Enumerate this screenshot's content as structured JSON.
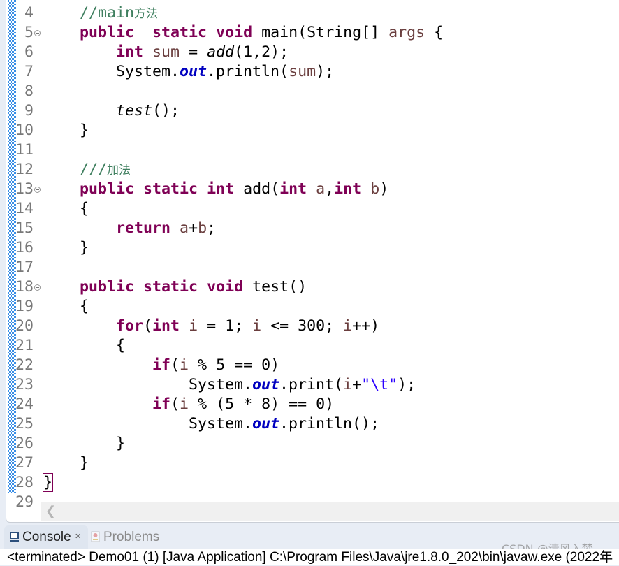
{
  "editor": {
    "lines": [
      {
        "n": "4",
        "fold": false,
        "indent": 1,
        "tokens": [
          [
            "cm",
            "//main"
          ],
          [
            "cmcjk",
            "方法"
          ]
        ]
      },
      {
        "n": "5",
        "fold": true,
        "indent": 1,
        "tokens": [
          [
            "kw",
            "public"
          ],
          [
            "",
            "  "
          ],
          [
            "kw",
            "static"
          ],
          [
            "",
            " "
          ],
          [
            "kw",
            "void"
          ],
          [
            "",
            " main(String[] "
          ],
          [
            "var",
            "args"
          ],
          [
            "",
            " {"
          ]
        ]
      },
      {
        "n": "6",
        "fold": false,
        "indent": 2,
        "tokens": [
          [
            "kw",
            "int"
          ],
          [
            "",
            " "
          ],
          [
            "var",
            "sum"
          ],
          [
            "",
            " = "
          ],
          [
            "it",
            "add"
          ],
          [
            "",
            "(1,2);"
          ]
        ]
      },
      {
        "n": "7",
        "fold": false,
        "indent": 2,
        "tokens": [
          [
            "",
            "System."
          ],
          [
            "fld",
            "out"
          ],
          [
            "",
            ".println("
          ],
          [
            "var",
            "sum"
          ],
          [
            "",
            ");"
          ]
        ]
      },
      {
        "n": "8",
        "fold": false,
        "indent": 0,
        "tokens": []
      },
      {
        "n": "9",
        "fold": false,
        "indent": 2,
        "tokens": [
          [
            "it",
            "test"
          ],
          [
            "",
            "();"
          ]
        ]
      },
      {
        "n": "10",
        "fold": false,
        "indent": 1,
        "tokens": [
          [
            "",
            "}"
          ]
        ]
      },
      {
        "n": "11",
        "fold": false,
        "indent": 0,
        "tokens": []
      },
      {
        "n": "12",
        "fold": false,
        "indent": 1,
        "tokens": [
          [
            "cm",
            "///"
          ],
          [
            "cmcjk",
            "加法"
          ]
        ]
      },
      {
        "n": "13",
        "fold": true,
        "indent": 1,
        "tokens": [
          [
            "kw",
            "public"
          ],
          [
            "",
            " "
          ],
          [
            "kw",
            "static"
          ],
          [
            "",
            " "
          ],
          [
            "kw",
            "int"
          ],
          [
            "",
            " add("
          ],
          [
            "kw",
            "int"
          ],
          [
            "",
            " "
          ],
          [
            "var",
            "a"
          ],
          [
            ","
          ],
          [
            "kw",
            "int"
          ],
          [
            "",
            " "
          ],
          [
            "var",
            "b"
          ],
          [
            "",
            ")"
          ]
        ]
      },
      {
        "n": "14",
        "fold": false,
        "indent": 1,
        "tokens": [
          [
            "",
            "{"
          ]
        ]
      },
      {
        "n": "15",
        "fold": false,
        "indent": 2,
        "tokens": [
          [
            "kw",
            "return"
          ],
          [
            "",
            " "
          ],
          [
            "var",
            "a"
          ],
          [
            "",
            "+"
          ],
          [
            "var",
            "b"
          ],
          [
            "",
            ";"
          ]
        ]
      },
      {
        "n": "16",
        "fold": false,
        "indent": 1,
        "tokens": [
          [
            "",
            "}"
          ]
        ]
      },
      {
        "n": "17",
        "fold": false,
        "indent": 0,
        "tokens": []
      },
      {
        "n": "18",
        "fold": true,
        "indent": 1,
        "tokens": [
          [
            "kw",
            "public"
          ],
          [
            "",
            " "
          ],
          [
            "kw",
            "static"
          ],
          [
            "",
            " "
          ],
          [
            "kw",
            "void"
          ],
          [
            "",
            " test()"
          ]
        ]
      },
      {
        "n": "19",
        "fold": false,
        "indent": 1,
        "tokens": [
          [
            "",
            "{"
          ]
        ]
      },
      {
        "n": "20",
        "fold": false,
        "indent": 2,
        "tokens": [
          [
            "kw",
            "for"
          ],
          [
            "",
            "("
          ],
          [
            "kw",
            "int"
          ],
          [
            "",
            " "
          ],
          [
            "var",
            "i"
          ],
          [
            "",
            " = 1; "
          ],
          [
            "var",
            "i"
          ],
          [
            "",
            " <= 300; "
          ],
          [
            "var",
            "i"
          ],
          [
            "",
            "++)"
          ]
        ]
      },
      {
        "n": "21",
        "fold": false,
        "indent": 2,
        "tokens": [
          [
            "",
            "{"
          ]
        ]
      },
      {
        "n": "22",
        "fold": false,
        "indent": 3,
        "tokens": [
          [
            "kw",
            "if"
          ],
          [
            "",
            "("
          ],
          [
            "var",
            "i"
          ],
          [
            "",
            " % 5 == 0)"
          ]
        ]
      },
      {
        "n": "23",
        "fold": false,
        "indent": 4,
        "tokens": [
          [
            "",
            "System."
          ],
          [
            "fld",
            "out"
          ],
          [
            "",
            ".print("
          ],
          [
            "var",
            "i"
          ],
          [
            "",
            "+"
          ],
          [
            "str",
            "\"\\t\""
          ],
          [
            "",
            ");"
          ]
        ]
      },
      {
        "n": "24",
        "fold": false,
        "indent": 3,
        "tokens": [
          [
            "kw",
            "if"
          ],
          [
            "",
            "("
          ],
          [
            "var",
            "i"
          ],
          [
            "",
            " % (5 * 8) == 0)"
          ]
        ]
      },
      {
        "n": "25",
        "fold": false,
        "indent": 4,
        "tokens": [
          [
            "",
            "System."
          ],
          [
            "fld",
            "out"
          ],
          [
            "",
            ".println();"
          ]
        ]
      },
      {
        "n": "26",
        "fold": false,
        "indent": 2,
        "tokens": [
          [
            "",
            "}"
          ]
        ]
      },
      {
        "n": "27",
        "fold": false,
        "indent": 1,
        "tokens": [
          [
            "",
            "}"
          ]
        ]
      },
      {
        "n": "28",
        "fold": false,
        "indent": 0,
        "tokens": [
          [
            "brk",
            "}"
          ]
        ]
      },
      {
        "n": "29",
        "fold": false,
        "indent": 0,
        "tokens": []
      }
    ],
    "scroll_left_icon": "chevron-left-icon"
  },
  "tabs": [
    {
      "label": "Console",
      "icon": "console-icon",
      "close": "✕",
      "active": true
    },
    {
      "label": "Problems",
      "icon": "problems-icon",
      "active": false
    }
  ],
  "console": {
    "text": "<terminated> Demo01 (1) [Java Application] C:\\Program Files\\Java\\jre1.8.0_202\\bin\\javaw.exe (2022年"
  },
  "watermark": "CSDN @清风入梦"
}
